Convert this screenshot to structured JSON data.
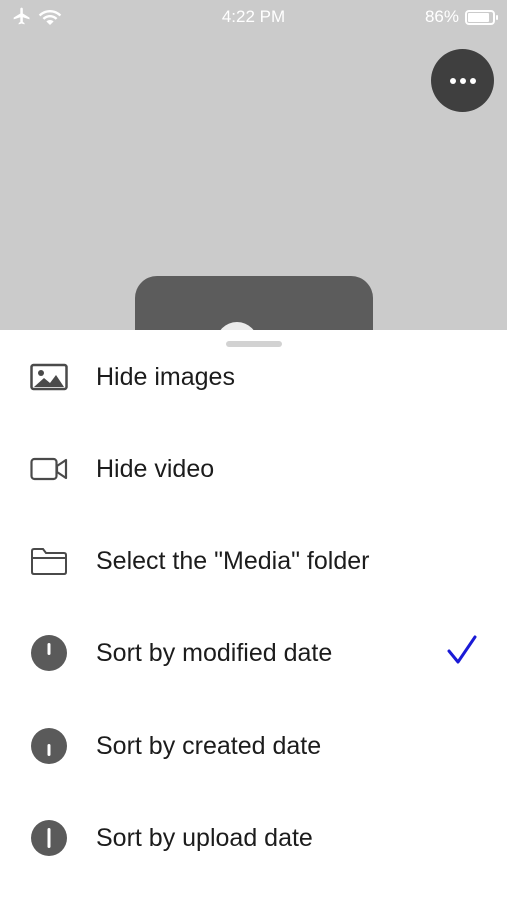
{
  "status_bar": {
    "time": "4:22 PM",
    "battery": "86%",
    "battery_level": 0.86,
    "icons": [
      "airplane-icon",
      "wifi-icon",
      "battery-icon"
    ]
  },
  "more_button": {
    "icon": "more-horizontal-icon"
  },
  "menu": {
    "items": [
      {
        "label": "Hide images",
        "icon": "image-icon",
        "checked": false
      },
      {
        "label": "Hide video",
        "icon": "video-camera-icon",
        "checked": false
      },
      {
        "label": "Select the \"Media\" folder",
        "icon": "folder-icon",
        "checked": false
      },
      {
        "label": "Sort by modified date",
        "icon": "clock-icon",
        "checked": true
      },
      {
        "label": "Sort by created date",
        "icon": "clock-icon",
        "checked": false
      },
      {
        "label": "Sort by upload date",
        "icon": "clock-icon",
        "checked": false
      }
    ]
  },
  "colors": {
    "checkmark": "#1a1ad6",
    "sort_icon": "#5a5a5a",
    "background": "#cbcbcb",
    "more_button": "#3f3f3f"
  }
}
